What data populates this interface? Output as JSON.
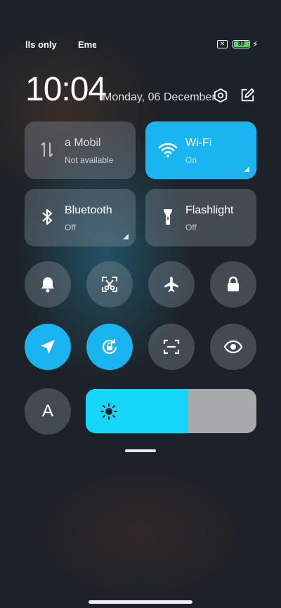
{
  "status_bar": {
    "carrier_1": "lls only",
    "carrier_2": "Emergency calls only",
    "battery_level": "89",
    "charging_icon": "bolt-icon",
    "sim_icon": "no-sim-icon"
  },
  "header": {
    "time": "10:04",
    "date": "Monday, 06 December",
    "settings_icon": "settings-hex-icon",
    "edit_icon": "edit-icon"
  },
  "tiles": {
    "mobile_data": {
      "title": "a      Mobil",
      "status": "Not available",
      "icon": "mobile-data-icon",
      "active": false
    },
    "wifi": {
      "title": "Wi-Fi",
      "status": "On",
      "icon": "wifi-icon",
      "active": true
    },
    "bluetooth": {
      "title": "Bluetooth",
      "status": "Off",
      "icon": "bluetooth-icon",
      "active": false
    },
    "flashlight": {
      "title": "Flashlight",
      "status": "Off",
      "icon": "flashlight-icon",
      "active": false
    }
  },
  "toggles": [
    {
      "icon": "bell-icon",
      "active": false
    },
    {
      "icon": "screenshot-scissors-icon",
      "active": false
    },
    {
      "icon": "airplane-icon",
      "active": false
    },
    {
      "icon": "lock-icon",
      "active": false
    },
    {
      "icon": "location-icon",
      "active": true
    },
    {
      "icon": "rotation-lock-icon",
      "active": true
    },
    {
      "icon": "scanner-icon",
      "active": false
    },
    {
      "icon": "eye-icon",
      "active": false
    }
  ],
  "auto_brightness": {
    "label": "A"
  },
  "brightness": {
    "level": 0.6,
    "icon": "sun-icon"
  },
  "colors": {
    "accent": "#1ab4f0",
    "slider": "#16d7fa",
    "tile": "#5a6470"
  }
}
